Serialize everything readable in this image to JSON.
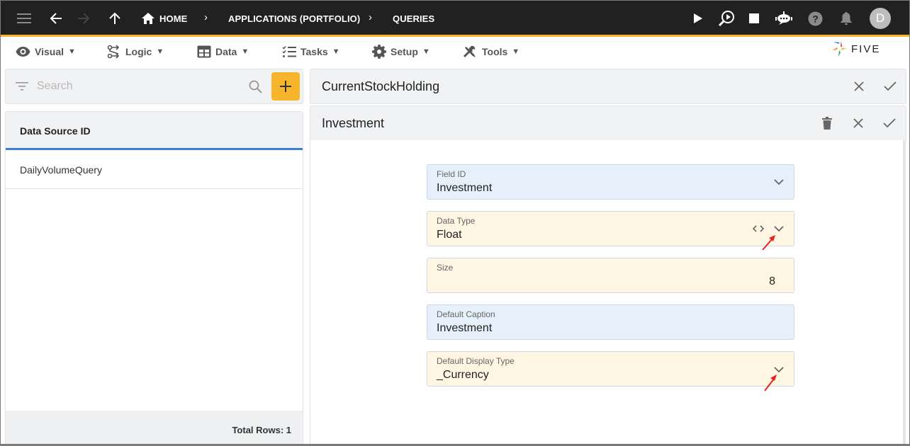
{
  "topbar": {
    "icons": [
      "menu-icon",
      "back-arrow-icon",
      "forward-arrow-icon",
      "up-arrow-icon"
    ],
    "breadcrumbs": [
      {
        "label": "HOME",
        "icon": "home-icon"
      },
      {
        "label": "APPLICATIONS (PORTFOLIO)"
      },
      {
        "label": "QUERIES"
      }
    ],
    "right_icons": [
      "play-icon",
      "run-search-icon",
      "stop-icon",
      "chat-bot-icon",
      "help-icon",
      "bell-icon"
    ],
    "avatar_initial": "D"
  },
  "menubar": {
    "items": [
      {
        "label": "Visual",
        "icon": "eye-icon"
      },
      {
        "label": "Logic",
        "icon": "logic-flow-icon"
      },
      {
        "label": "Data",
        "icon": "table-icon"
      },
      {
        "label": "Tasks",
        "icon": "checklist-icon"
      },
      {
        "label": "Setup",
        "icon": "gear-icon"
      },
      {
        "label": "Tools",
        "icon": "tools-icon"
      }
    ],
    "dropdown_glyph": "▼",
    "logo_text": "FIVE"
  },
  "left_panel": {
    "search_placeholder": "Search",
    "add_button_label": "+",
    "column_header": "Data Source ID",
    "rows": [
      "DailyVolumeQuery"
    ],
    "footer": "Total Rows: 1"
  },
  "main": {
    "parent_record": {
      "title": "CurrentStockHolding"
    },
    "child_record": {
      "title": "Investment"
    },
    "fields": [
      {
        "label": "Field ID",
        "value": "Investment",
        "type": "select",
        "color": "blue"
      },
      {
        "label": "Data Type",
        "value": "Float",
        "type": "select-code",
        "color": "amber"
      },
      {
        "label": "Size",
        "value": "8",
        "type": "number",
        "color": "amber"
      },
      {
        "label": "Default Caption",
        "value": "Investment",
        "type": "text",
        "color": "blue"
      },
      {
        "label": "Default Display Type",
        "value": "_Currency",
        "type": "select",
        "color": "amber"
      }
    ]
  },
  "colors": {
    "topbar_bg": "#212121",
    "accent": "#f6b52a",
    "selected_underline": "#3d7fd6",
    "field_blue": "#e6f0fb",
    "field_amber": "#fef5e2",
    "annotation_arrow": "#e8231f"
  }
}
